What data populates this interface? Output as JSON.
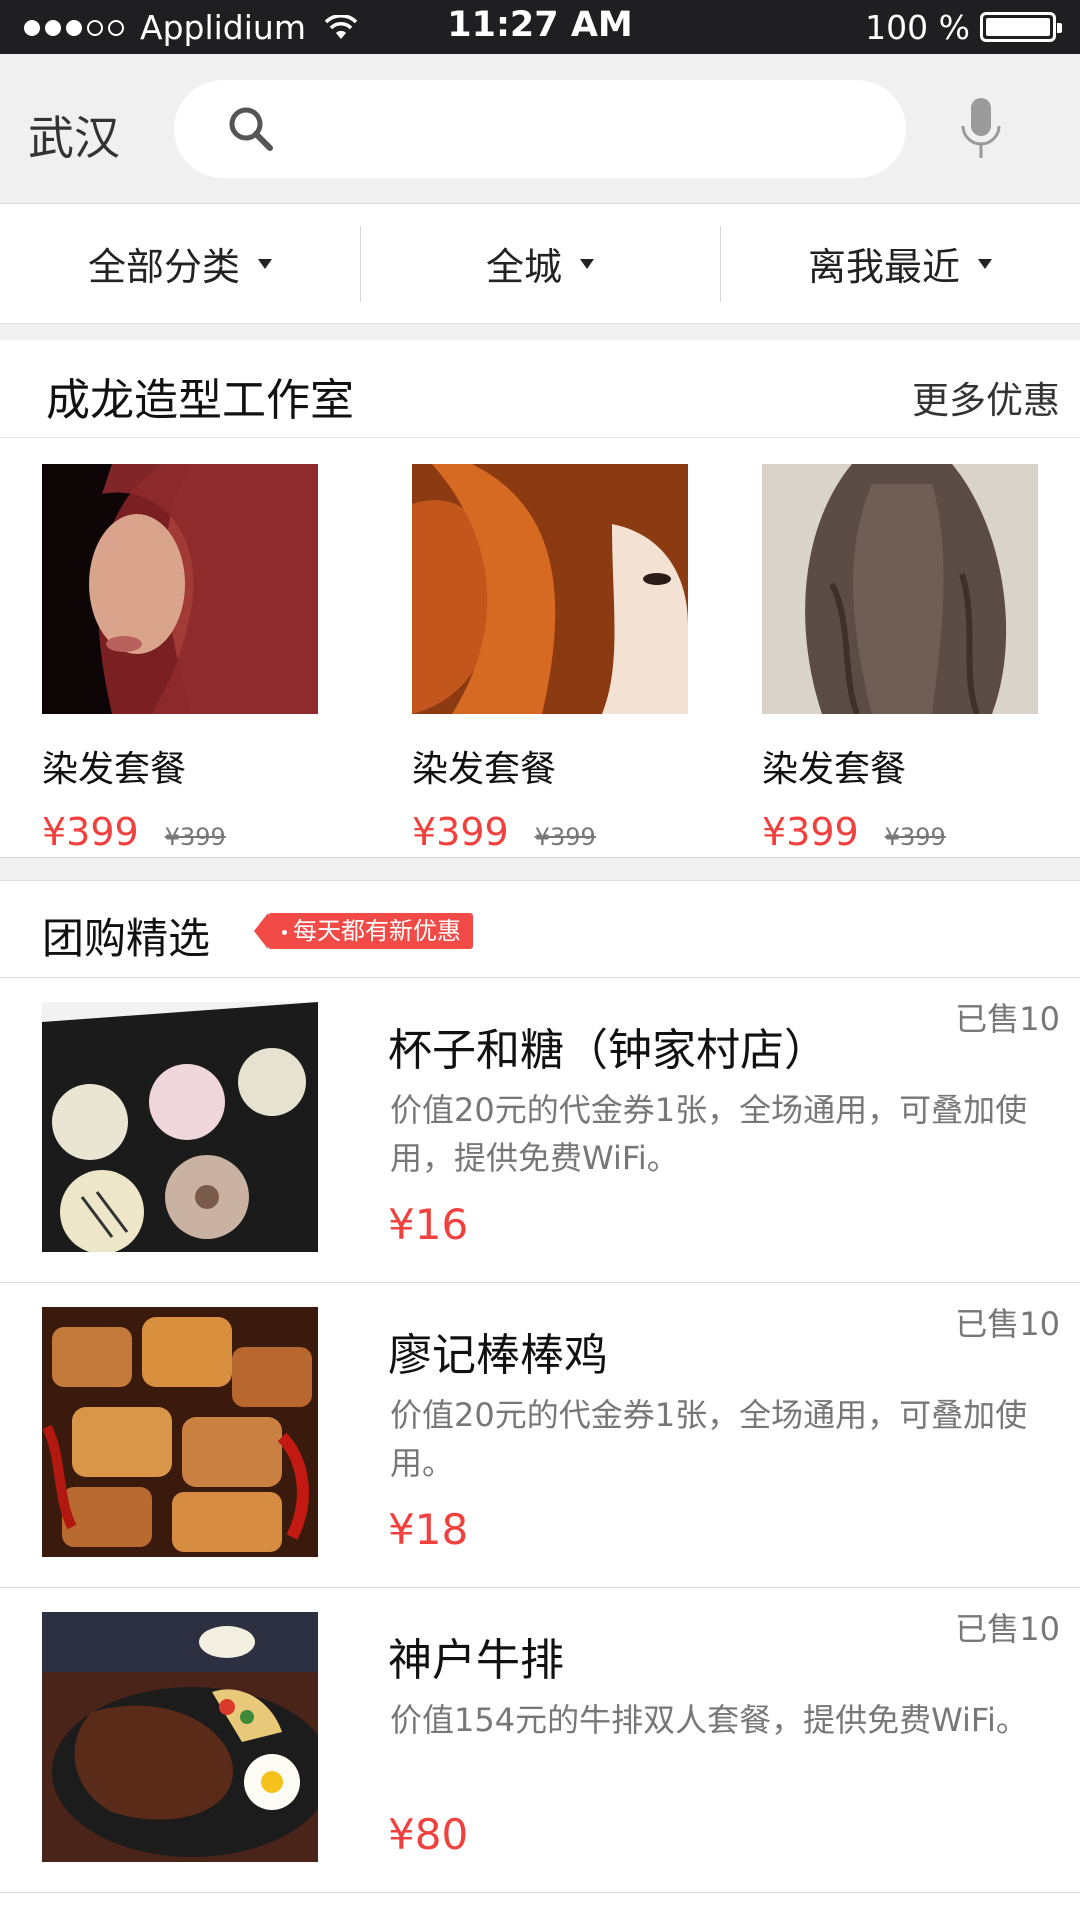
{
  "status_bar": {
    "carrier": "Applidium",
    "time": "11:27 AM",
    "battery": "100 %"
  },
  "header": {
    "city": "武汉",
    "search_placeholder": ""
  },
  "filters": [
    {
      "label": "全部分类"
    },
    {
      "label": "全城"
    },
    {
      "label": "离我最近"
    }
  ],
  "shop": {
    "name": "成龙造型工作室",
    "more_label": "更多优惠",
    "deals": [
      {
        "title": "染发套餐",
        "price": "¥399",
        "original_price": "¥399"
      },
      {
        "title": "染发套餐",
        "price": "¥399",
        "original_price": "¥399"
      },
      {
        "title": "染发套餐",
        "price": "¥399",
        "original_price": "¥399"
      }
    ]
  },
  "group_buy": {
    "title": "团购精选",
    "badge": "每天都有新优惠",
    "items": [
      {
        "name": "杯子和糖（钟家村店）",
        "desc": "价值20元的代金券1张，全场通用，可叠加使用，提供免费WiFi。",
        "price": "¥16",
        "sold": "已售10"
      },
      {
        "name": "廖记棒棒鸡",
        "desc": "价值20元的代金券1张，全场通用，可叠加使用。",
        "price": "¥18",
        "sold": "已售10"
      },
      {
        "name": "神户牛排",
        "desc": "价值154元的牛排双人套餐，提供免费WiFi。",
        "price": "¥80",
        "sold": "已售10"
      }
    ]
  },
  "icons": {
    "search": "search-icon",
    "mic": "microphone-icon",
    "wifi": "wifi-icon",
    "battery": "battery-icon",
    "dropdown": "caret-down-icon"
  },
  "colors": {
    "accent": "#f0413e",
    "status_bar": "#1f1f21",
    "header_bg": "#f0f0f0"
  }
}
